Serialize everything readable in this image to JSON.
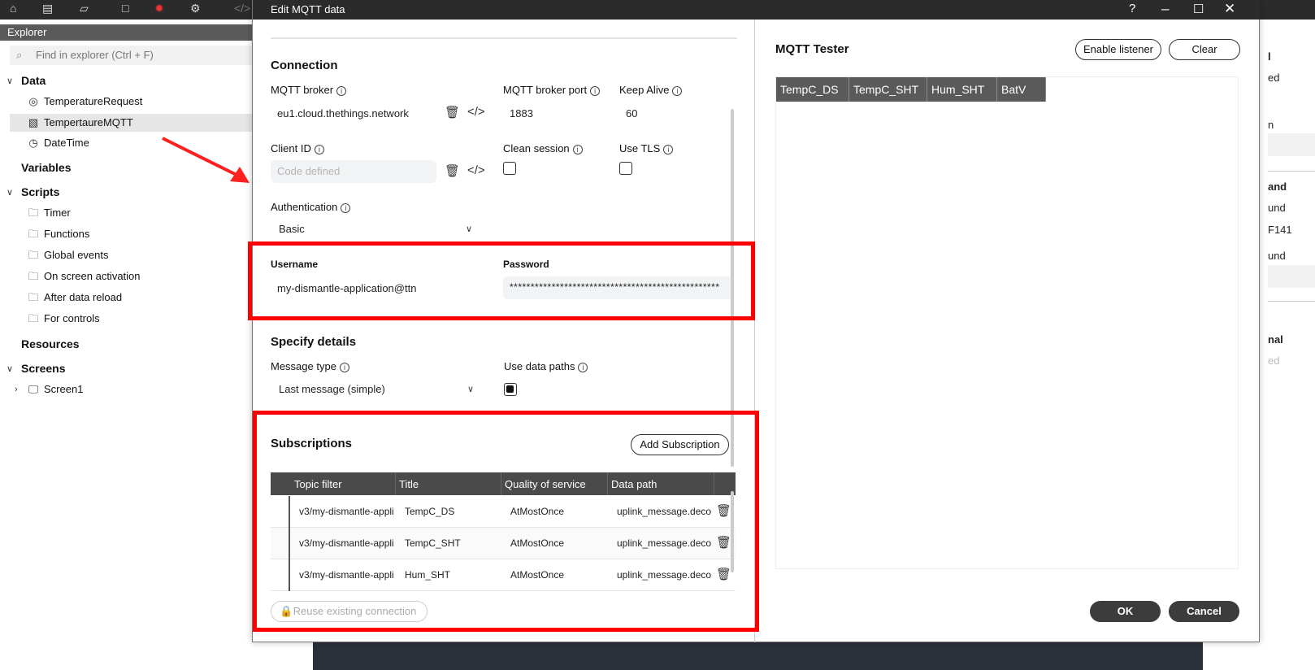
{
  "dialog": {
    "title": "Edit MQTT data",
    "help": "?"
  },
  "explorer": {
    "header": "Explorer",
    "search_placeholder": "Find in explorer (Ctrl + F)",
    "sections": {
      "data": "Data",
      "variables": "Variables",
      "scripts": "Scripts",
      "resources": "Resources",
      "screens": "Screens"
    },
    "data_items": [
      "TemperatureRequest",
      "TempertaureMQTT",
      "DateTime"
    ],
    "script_items": [
      "Timer",
      "Functions",
      "Global events",
      "On screen activation",
      "After data reload",
      "For controls"
    ],
    "screen_items": [
      "Screen1"
    ]
  },
  "right_edge": [
    "l",
    "ed",
    "n",
    "and",
    "und",
    "F141",
    "und",
    "nal",
    "ed"
  ],
  "connection": {
    "title": "Connection",
    "broker_label": "MQTT broker",
    "broker_value": "eu1.cloud.thethings.network",
    "port_label": "MQTT broker port",
    "port_value": "1883",
    "keepalive_label": "Keep Alive",
    "keepalive_value": "60",
    "clientid_label": "Client ID",
    "clientid_placeholder": "Code defined",
    "clean_session_label": "Clean session",
    "clean_session_checked": false,
    "use_tls_label": "Use TLS",
    "use_tls_checked": false,
    "auth_label": "Authentication",
    "auth_value": "Basic",
    "username_label": "Username",
    "username_value": "my-dismantle-application@ttn",
    "password_label": "Password",
    "password_value": "**************************************************"
  },
  "details": {
    "title": "Specify details",
    "message_type_label": "Message type",
    "message_type_value": "Last message (simple)",
    "use_data_paths_label": "Use data paths",
    "use_data_paths_checked": true
  },
  "subscriptions": {
    "title": "Subscriptions",
    "add_button": "Add Subscription",
    "columns": [
      "Topic filter",
      "Title",
      "Quality of service",
      "Data path"
    ],
    "rows": [
      {
        "topic": "v3/my-dismantle-appli",
        "title": "TempC_DS",
        "qos": "AtMostOnce",
        "path": "uplink_message.decoc"
      },
      {
        "topic": "v3/my-dismantle-appli",
        "title": "TempC_SHT",
        "qos": "AtMostOnce",
        "path": "uplink_message.decoc"
      },
      {
        "topic": "v3/my-dismantle-appli",
        "title": "Hum_SHT",
        "qos": "AtMostOnce",
        "path": "uplink_message.decoc"
      }
    ],
    "reuse_button": "Reuse existing connection"
  },
  "tester": {
    "title": "MQTT Tester",
    "enable_listener": "Enable listener",
    "clear": "Clear",
    "columns": [
      "TempC_DS",
      "TempC_SHT",
      "Hum_SHT",
      "BatV"
    ]
  },
  "footer": {
    "ok": "OK",
    "cancel": "Cancel"
  },
  "colors": {
    "highlight": "#ff0000",
    "titlebar": "#2b2b2b",
    "table_header": "#4a4a4a"
  }
}
